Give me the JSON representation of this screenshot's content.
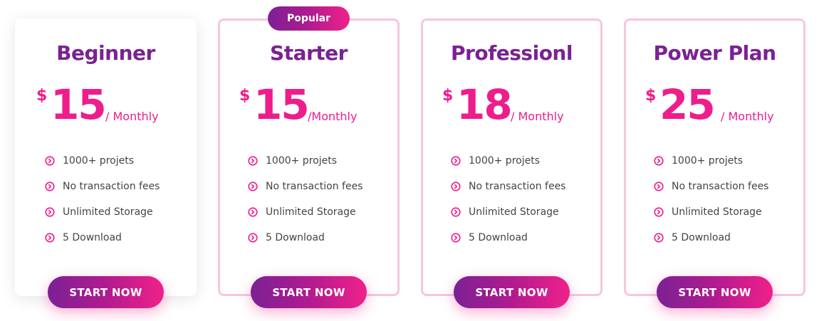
{
  "badge": {
    "label": "Popular"
  },
  "colors": {
    "accent_purple": "#7b2194",
    "accent_pink": "#ee1d8c",
    "popular_border": "#f7c6dd"
  },
  "plans": [
    {
      "name": "Beginner",
      "currency": "$",
      "price": "15",
      "period": "/ Monthly",
      "features": [
        "1000+ projets",
        "No transaction fees",
        "Unlimited Storage",
        "5 Download"
      ],
      "cta": "START NOW"
    },
    {
      "name": "Starter",
      "currency": "$",
      "price": "15",
      "period": "/Monthly",
      "features": [
        "1000+ projets",
        "No transaction fees",
        "Unlimited Storage",
        "5 Download"
      ],
      "cta": "START NOW"
    },
    {
      "name": "Professionl",
      "currency": "$",
      "price": "18",
      "period": "/ Monthly",
      "features": [
        "1000+ projets",
        "No transaction fees",
        "Unlimited Storage",
        "5 Download"
      ],
      "cta": "START NOW"
    },
    {
      "name": "Power Plan",
      "currency": "$",
      "price": "25",
      "period": "/ Monthly",
      "features": [
        "1000+ projets",
        "No transaction fees",
        "Unlimited Storage",
        "5 Download"
      ],
      "cta": "START NOW"
    }
  ]
}
